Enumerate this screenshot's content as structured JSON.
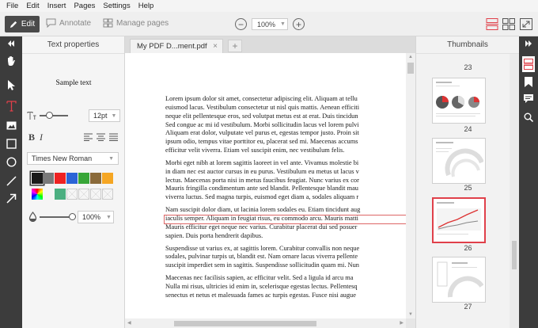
{
  "menu": [
    "File",
    "Edit",
    "Insert",
    "Pages",
    "Settings",
    "Help"
  ],
  "toolbar": {
    "edit_label": "Edit",
    "annotate_label": "Annotate",
    "manage_pages_label": "Manage pages",
    "zoom_value": "100%",
    "accent_color": "#e0404a"
  },
  "props": {
    "title": "Text properties",
    "sample_text": "Sample text",
    "font_size": "12pt",
    "bold": "B",
    "italic": "I",
    "font_family": "Times New Roman",
    "opacity": "100%",
    "colors": [
      "#1a1a1a",
      "#7a7a7a",
      "#ee2222",
      "#2b64d6",
      "#38a638",
      "#8a6a3a",
      "#f5a623"
    ],
    "extra_colors": [
      "#4caf81"
    ]
  },
  "tab": {
    "title": "My PDF D...ment.pdf",
    "close": "×",
    "add": "+"
  },
  "document": {
    "paragraphs": [
      [
        "Lorem ipsum dolor sit amet, consectetur adipiscing elit. Aliquam at tellu",
        "euismod lacus. Vestibulum consectetur ut nisl quis mattis. Aenean efficiti",
        "neque elit pellentesque eros, sed volutpat metus est at erat. Duis tincidun",
        "Sed congue ac mi id vestibulum. Morbi sollicitudin lacus vel lorem pulvi",
        "Aliquam erat dolor, vulputate vel purus et, egestas tempor justo. Proin sit",
        "ipsum odio, tempus vitae porttitor eu, placerat sed mi. Maecenas accums",
        "efficitur velit viverra. Etiam vel suscipit enim, nec vestibulum felis."
      ],
      [
        "Morbi eget nibh at lorem sagittis laoreet in vel ante. Vivamus molestie bi",
        "in diam nec est auctor cursus in eu purus. Vestibulum eu metus ut lacus v",
        "lectus. Maecenas porta nisi in metus faucibus feugiat. Nunc varius ex cor",
        "Mauris fringilla condimentum ante sed blandit. Pellentesque blandit mau",
        "viverra luctus. Sed magna turpis, euismod eget diam a, sodales aliquam r"
      ],
      [
        "Nam suscipit dolor diam, ut lacinia lorem sodales eu. Etiam tincidunt aug",
        "iaculis semper. Aliquam in feugiat risus, eu commodo arcu. Mauris matti",
        "Mauris efficitur eget neque nec varius. Curabitur placerat dui sed posuer",
        "sapien. Duis porta hendrerit dapibus."
      ],
      [
        "Suspendisse ut varius ex, at sagittis lorem. Curabitur convallis non neque",
        "sodales, pulvinar turpis ut, blandit est. Nam ornare lacus viverra pellente",
        "suscipit imperdiet sem in sagittis. Suspendisse sollicitudin quam mi. Nun"
      ],
      [
        "Maecenas nec facilisis sapien, ac efficitur velit. Sed a ligula id arcu ma",
        "Nulla mi risus, ultricies id enim in, scelerisque egestas lectus. Pellentesq",
        "senectus et netus et malesuada fames ac turpis egestas. Fusce nisi augue"
      ]
    ]
  },
  "thumbnails": {
    "title": "Thumbnails",
    "pages": [
      "23",
      "24",
      "25",
      "26",
      "27"
    ]
  }
}
